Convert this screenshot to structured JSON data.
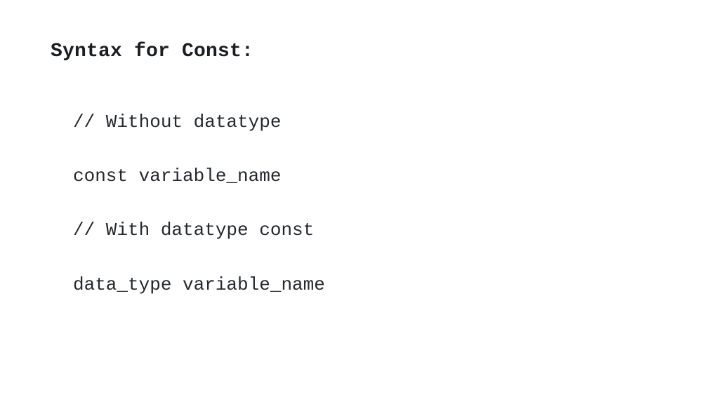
{
  "title": "Syntax for Const:",
  "code": {
    "line1": "// Without datatype",
    "line2": "const variable_name",
    "line3": "// With datatype const",
    "line4": "data_type variable_name"
  }
}
